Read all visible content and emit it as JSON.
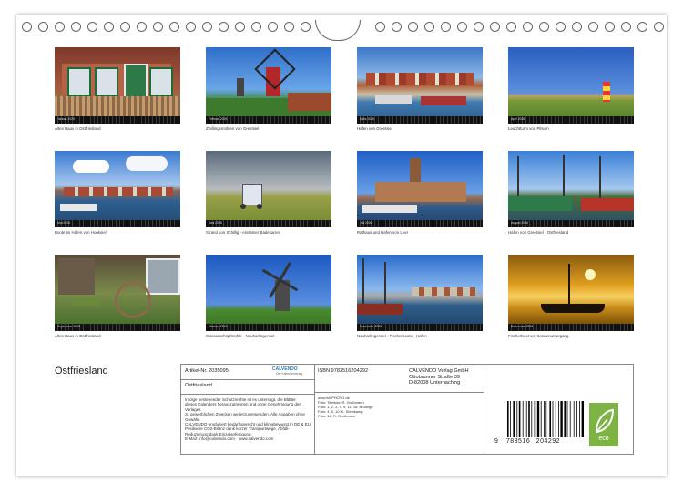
{
  "calendar": {
    "title": "Ostfriesland",
    "months": [
      {
        "label": "Januar 2026",
        "caption": "Altes Haus in Ostfriesland"
      },
      {
        "label": "Februar 2026",
        "caption": "Zwillingsmühlen von Greetsiel"
      },
      {
        "label": "März 2026",
        "caption": "Hafen von Greetsiel"
      },
      {
        "label": "April 2026",
        "caption": "Leuchtturm von Pilsum"
      },
      {
        "label": "Mai 2026",
        "caption": "Boote im Hafen von Hooksiel"
      },
      {
        "label": "Juni 2026",
        "caption": "Strand von Schillig - einsamer Badekarren"
      },
      {
        "label": "Juli 2026",
        "caption": "Rathaus und Hafen von Leer"
      },
      {
        "label": "August 2026",
        "caption": "Hafen von Greetsiel - Ostfriesland"
      },
      {
        "label": "September 2026",
        "caption": "Altes Haus in Ostfriesland"
      },
      {
        "label": "Oktober 2026",
        "caption": "Wasserschöpfmühle - Neuharlingersiel"
      },
      {
        "label": "November 2026",
        "caption": "Neuharlingersiel - Fischerboote - Hafen"
      },
      {
        "label": "Dezember 2026",
        "caption": "Fischerboot vor Sonnenuntergang"
      }
    ]
  },
  "imprint": {
    "article": "Artikel-Nr. 2035095",
    "product_title": "Ostfriesland",
    "logo_text": "CALVENDO",
    "logo_sub": "Der Kalenderverlag",
    "isbn": "ISBN 9783516204292",
    "publisher_lines": [
      "CALVENDO Verlag GmbH",
      "Ottobrunner Straße 39",
      "D-82008 Unterhaching"
    ],
    "photo_credits": [
      "www.MoPHOTO.de",
      "Foto: Titelfoto: R. Großmann",
      "Foto: 1, 2, 3, 5, 9, 11, 16: Bruunge",
      "Foto: 4, 5, 10: K. Steinkamp",
      "Foto: 12: R. Großmann"
    ],
    "legal": [
      "Infolge bestehender Schutzrechte ist es untersagt, die Blätter",
      "dieses Kalenders herauszutrennen und ohne Genehmigung des Verlages",
      "zu gewerblichen Zwecken weiterzuverwenden. Alle Angaben ohne",
      "Gewähr.",
      "CALVENDO produziert bedarfsgerecht und klimabewusst in DE & EU.",
      "Positivere CO2-Bilanz dank kurzer Transportwege. Abfall-",
      "Reduzierung dank Einzelanfertigung.",
      "E-Mail: info@calvendo.com · www.calvendo.com"
    ],
    "barcode_digits": [
      "9",
      "783516",
      "204292"
    ],
    "eco_label": "eco"
  }
}
